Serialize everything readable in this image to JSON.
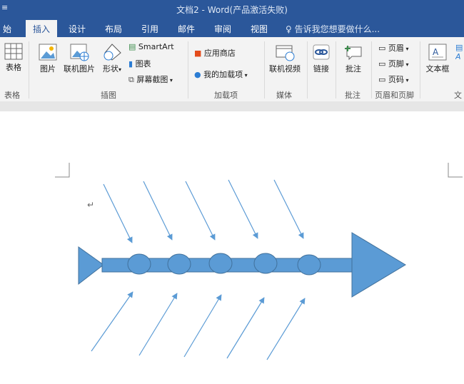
{
  "window": {
    "title": "文档2 - Word(产品激活失败)",
    "quick_access": "≡"
  },
  "tabs": [
    {
      "label": "始"
    },
    {
      "label": "插入",
      "active": true
    },
    {
      "label": "设计"
    },
    {
      "label": "布局"
    },
    {
      "label": "引用"
    },
    {
      "label": "邮件"
    },
    {
      "label": "审阅"
    },
    {
      "label": "视图"
    }
  ],
  "tell_me": "告诉我您想要做什么...",
  "ribbon": {
    "table_btn": "表格",
    "picture_btn": "图片",
    "online_picture_btn": "联机图片",
    "shapes_btn": "形状",
    "smartart_btn": "SmartArt",
    "chart_btn": "图表",
    "screenshot_btn": "屏幕截图",
    "app_store_btn": "应用商店",
    "my_addins_btn": "我的加载项",
    "online_video_btn": "联机视频",
    "link_btn": "链接",
    "comment_btn": "批注",
    "header_btn": "页眉",
    "footer_btn": "页脚",
    "page_number_btn": "页码",
    "textbox_btn": "文本框",
    "more_btn": "文",
    "groups": {
      "tables": "表格",
      "illustrations": "插图",
      "addins": "加载项",
      "media": "媒体",
      "comments": "批注",
      "header_footer": "页眉和页脚"
    }
  },
  "document": {
    "paragraph_mark": "↵",
    "colors": {
      "shape_fill": "#5b9bd5",
      "shape_stroke": "#41719c",
      "arrow_line": "#5b9bd5"
    }
  }
}
